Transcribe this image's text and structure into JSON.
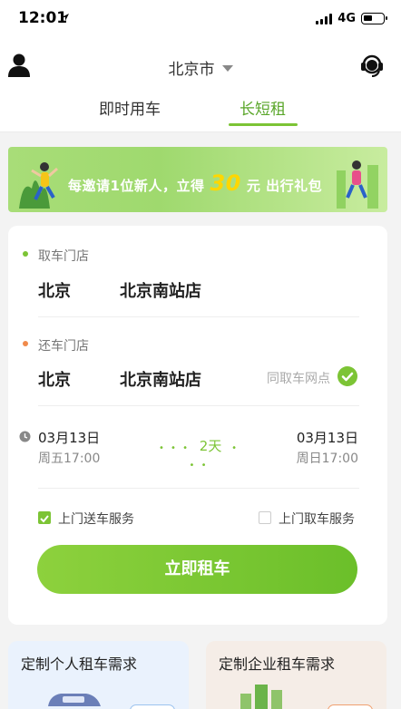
{
  "status": {
    "time": "12:01",
    "network": "4G"
  },
  "header": {
    "city": "北京市"
  },
  "tabs": [
    {
      "label": "即时用车"
    },
    {
      "label": "长短租"
    }
  ],
  "banner": {
    "text_pre": "每邀请1位新人，立得",
    "amount": "30",
    "text_post": "元 出行礼包"
  },
  "pickup": {
    "label": "取车门店",
    "city": "北京",
    "store": "北京南站店"
  },
  "dropoff": {
    "label": "还车门店",
    "city": "北京",
    "store": "北京南站店",
    "same_label": "同取车网点"
  },
  "schedule": {
    "start_date": "03月13日",
    "start_time": "周五17:00",
    "duration": "2天",
    "end_date": "03月13日",
    "end_time": "周日17:00"
  },
  "options": {
    "delivery": "上门送车服务",
    "pickup_service": "上门取车服务"
  },
  "rent_button": "立即租车",
  "bottom": {
    "personal": "定制个人租车需求",
    "enterprise": "定制企业租车需求"
  },
  "colors": {
    "accent": "#7cc435",
    "dropoff_dot": "#f08a4b"
  },
  "icons": {
    "profile": "profile-icon",
    "caret": "caret-down-icon",
    "service": "customer-service-icon",
    "clock": "clock-icon",
    "check": "check-circle-icon",
    "location_arrow": "location-arrow-icon"
  }
}
